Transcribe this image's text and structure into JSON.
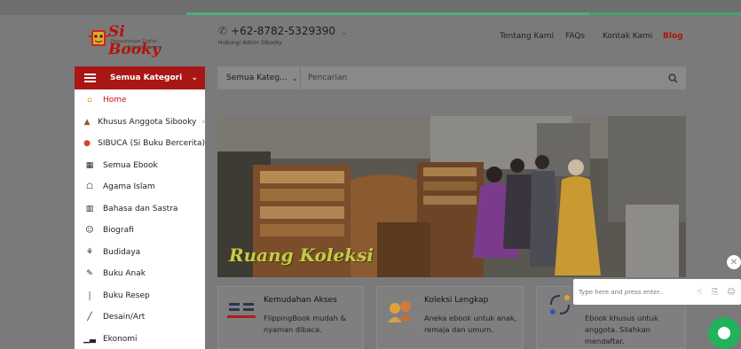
{
  "header": {
    "logo_title": "Si Booky",
    "logo_sub1": "Perpustakaan Digital",
    "logo_sub2": "Kota Semarang",
    "phone": "+62-8782-5329390",
    "phone_sub": "Hubungi Admin Sibooky",
    "nav": [
      "Tentang Kami",
      "FAQs",
      "Kontak Kami",
      "Blog"
    ]
  },
  "category_button": {
    "label": "Semua Kategori"
  },
  "search": {
    "category_selected": "Semua Kateg...",
    "placeholder": "Pencarian"
  },
  "menu": {
    "items": [
      {
        "label": "Home",
        "icon": "home-icon",
        "active": true
      },
      {
        "label": "Khusus Anggota Sibooky",
        "icon": "members-icon",
        "has_submenu": true
      },
      {
        "label": "SIBUCA (Si Buku Bercerita)",
        "icon": "story-icon"
      },
      {
        "label": "Semua Ebook",
        "icon": "ebook-icon"
      },
      {
        "label": "Agama Islam",
        "icon": "mosque-icon"
      },
      {
        "label": "Bahasa dan Sastra",
        "icon": "language-icon"
      },
      {
        "label": "Biografi",
        "icon": "person-icon"
      },
      {
        "label": "Budidaya",
        "icon": "cultivation-icon"
      },
      {
        "label": "Buku Anak",
        "icon": "child-book-icon"
      },
      {
        "label": "Buku Resep",
        "icon": "utensils-icon"
      },
      {
        "label": "Desain/Art",
        "icon": "brush-icon"
      },
      {
        "label": "Ekonomi",
        "icon": "chart-icon"
      }
    ]
  },
  "banner": {
    "caption": "Ruang Koleksi"
  },
  "features": [
    {
      "title": "Kemudahan Akses",
      "desc": [
        "FlippingBook mudah &",
        "nyaman dibaca."
      ]
    },
    {
      "title": "Koleksi Lengkap",
      "desc": [
        "Aneka ebook untuk anak,",
        "remaja dan umum."
      ]
    },
    {
      "title": "",
      "desc": [
        "Ebook khusus untuk",
        "anggota. Silahkan",
        "mendaftar."
      ]
    }
  ],
  "chat": {
    "placeholder": "Type here and press enter.."
  },
  "colors": {
    "brand_red": "#a81715",
    "chat_green": "#1fb35a",
    "caption_yellow": "#c7cb45"
  }
}
